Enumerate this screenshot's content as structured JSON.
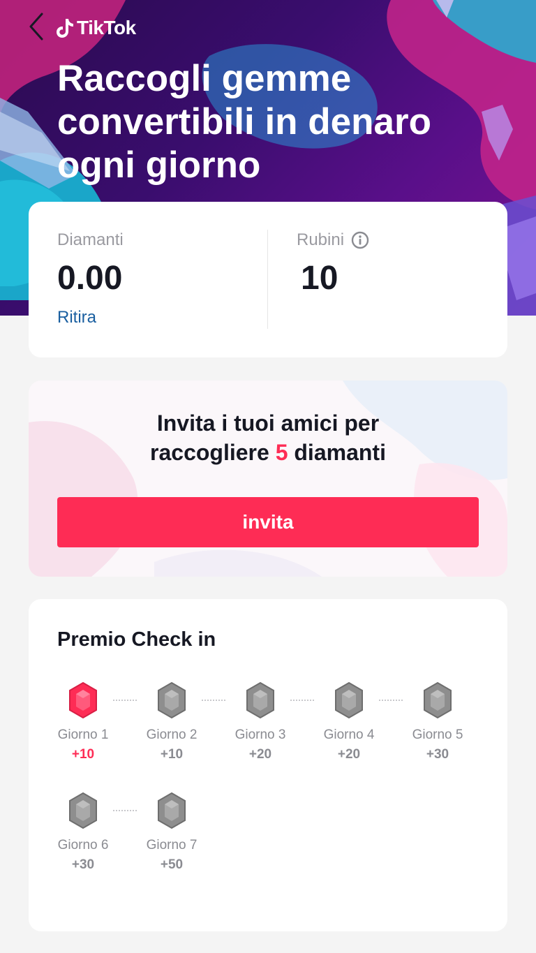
{
  "header": {
    "brand": "TikTok",
    "title_lines": [
      "Raccogli gemme",
      "convertibili in denaro",
      "ogni giorno"
    ]
  },
  "balance": {
    "diamonds_label": "Diamanti",
    "diamonds_value": "0.00",
    "withdraw_label": "Ritira",
    "rubies_label": "Rubini",
    "rubies_value": "10"
  },
  "invite": {
    "line1": "Invita i tuoi amici per",
    "line2_prefix": "raccogliere ",
    "line2_highlight": "5",
    "line2_suffix": " diamanti",
    "button_label": "invita"
  },
  "checkin": {
    "title": "Premio Check in",
    "days": [
      {
        "label": "Giorno 1",
        "reward": "+10",
        "active": true
      },
      {
        "label": "Giorno 2",
        "reward": "+10",
        "active": false
      },
      {
        "label": "Giorno 3",
        "reward": "+20",
        "active": false
      },
      {
        "label": "Giorno 4",
        "reward": "+20",
        "active": false
      },
      {
        "label": "Giorno 5",
        "reward": "+30",
        "active": false
      },
      {
        "label": "Giorno 6",
        "reward": "+30",
        "active": false
      },
      {
        "label": "Giorno 7",
        "reward": "+50",
        "active": false
      }
    ]
  },
  "colors": {
    "accent": "#fe2c55",
    "link": "#1a5fa0",
    "gem_inactive": "#8e8e8e"
  }
}
